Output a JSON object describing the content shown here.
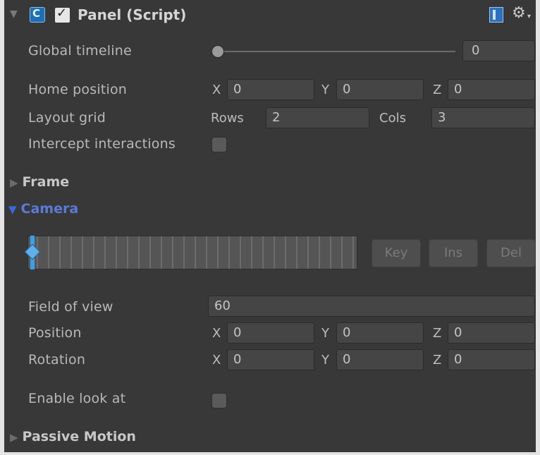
{
  "header": {
    "title": "Panel (Script)",
    "enabled": true
  },
  "global_timeline": {
    "label": "Global timeline",
    "value": "0",
    "slider_level": 0
  },
  "home_position": {
    "label": "Home position",
    "x_label": "X",
    "x": "0",
    "y_label": "Y",
    "y": "0",
    "z_label": "Z",
    "z": "0"
  },
  "layout_grid": {
    "label": "Layout grid",
    "rows_label": "Rows",
    "rows": "2",
    "cols_label": "Cols",
    "cols": "3"
  },
  "intercept_interactions": {
    "label": "Intercept interactions",
    "checked": false
  },
  "sections": {
    "frame": "Frame",
    "camera": "Camera",
    "passive_motion": "Passive Motion"
  },
  "timeline_buttons": {
    "key": "Key",
    "ins": "Ins",
    "del": "Del"
  },
  "field_of_view": {
    "label": "Field of view",
    "value": "60"
  },
  "position": {
    "label": "Position",
    "x_label": "X",
    "x": "0",
    "y_label": "Y",
    "y": "0",
    "z_label": "Z",
    "z": "0"
  },
  "rotation": {
    "label": "Rotation",
    "x_label": "X",
    "x": "0",
    "y_label": "Y",
    "y": "0",
    "z_label": "Z",
    "z": "0"
  },
  "enable_look_at": {
    "label": "Enable look at",
    "checked": false
  },
  "icons": [
    "foldout-arrow-icon",
    "script-icon",
    "checkbox-check-icon",
    "help-book-icon",
    "gear-icon",
    "playhead-keyframe-icon"
  ],
  "colors": {
    "background": "#383838",
    "field": "#454545",
    "accent_blue": "#5b7bd8",
    "playhead": "#3aa0e8"
  }
}
